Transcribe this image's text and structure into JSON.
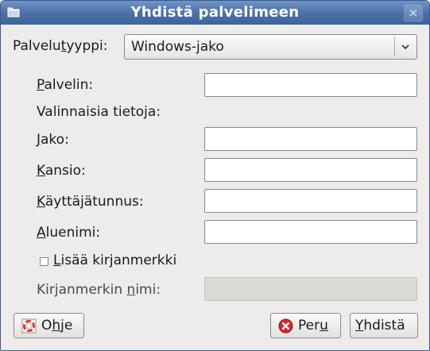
{
  "window": {
    "title": "Yhdistä palvelimeen",
    "close_symbol": "×"
  },
  "service_type": {
    "label_before": "Palvelu",
    "label_mnemonic": "t",
    "label_after": "yyppi:",
    "value": "Windows-jako"
  },
  "fields": {
    "server": {
      "mnemonic": "P",
      "rest": "alvelin:"
    },
    "optional_heading": "Valinnaisia tietoja:",
    "share": {
      "mnemonic": "J",
      "rest": "ako:"
    },
    "folder": {
      "mnemonic": "K",
      "rest": "ansio:"
    },
    "username": {
      "mnemonic": "K",
      "rest": "äyttäjätunnus:"
    },
    "domain": {
      "mnemonic": "A",
      "rest": "luenimi:"
    }
  },
  "bookmark": {
    "checkbox_mnemonic": "L",
    "checkbox_rest": "isää kirjanmerkki",
    "checked": false,
    "name_before": "Kirjanmerkin ",
    "name_mnemonic": "n",
    "name_after": "imi:"
  },
  "buttons": {
    "help": {
      "before": "O",
      "mnemonic": "h",
      "after": "je",
      "icon": "lifebuoy-icon"
    },
    "cancel": {
      "before": "Per",
      "mnemonic": "u",
      "after": "",
      "icon": "cancel-icon"
    },
    "connect": {
      "before": "",
      "mnemonic": "Y",
      "after": "hdistä"
    }
  }
}
